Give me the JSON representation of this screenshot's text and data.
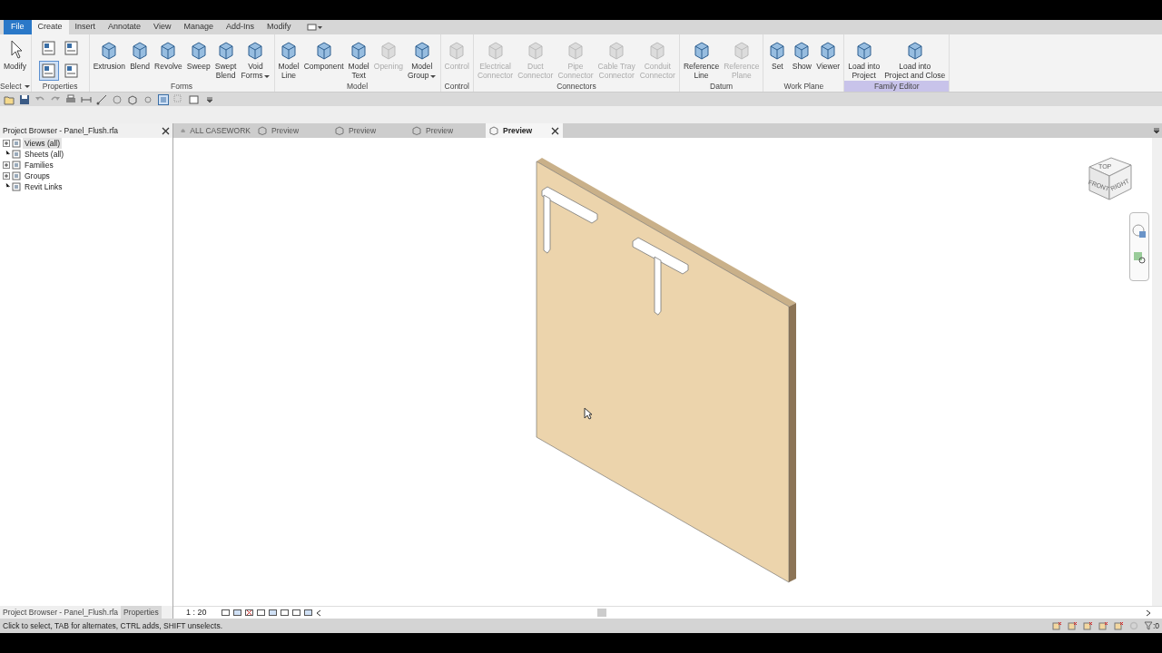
{
  "ribbon_tabs": [
    {
      "label": "File",
      "kind": "application",
      "selected": false
    },
    {
      "label": "Create",
      "kind": "tab",
      "selected": true
    },
    {
      "label": "Insert",
      "kind": "tab",
      "selected": false
    },
    {
      "label": "Annotate",
      "kind": "tab",
      "selected": false
    },
    {
      "label": "View",
      "kind": "tab",
      "selected": false
    },
    {
      "label": "Manage",
      "kind": "tab",
      "selected": false
    },
    {
      "label": "Add-Ins",
      "kind": "tab",
      "selected": false
    },
    {
      "label": "Modify",
      "kind": "tab",
      "selected": false
    }
  ],
  "ribbon_panels": [
    {
      "label": "Select",
      "dropdown": true,
      "highlighted": false,
      "tools": [
        {
          "lines": [
            "Modify"
          ],
          "disabled": false,
          "dropdown": false
        }
      ]
    },
    {
      "label": "Properties",
      "dropdown": false,
      "highlighted": false,
      "icon_tools": [
        {
          "selected": false
        },
        {
          "selected": false
        },
        {
          "selected": true
        },
        {
          "selected": false
        }
      ]
    },
    {
      "label": "Forms",
      "dropdown": false,
      "highlighted": false,
      "tools": [
        {
          "lines": [
            "Extrusion"
          ],
          "disabled": false,
          "dropdown": false
        },
        {
          "lines": [
            "Blend"
          ],
          "disabled": false,
          "dropdown": false
        },
        {
          "lines": [
            "Revolve"
          ],
          "disabled": false,
          "dropdown": false
        },
        {
          "lines": [
            "Sweep"
          ],
          "disabled": false,
          "dropdown": false
        },
        {
          "lines": [
            "Swept",
            "Blend"
          ],
          "disabled": false,
          "dropdown": false
        },
        {
          "lines": [
            "Void",
            "Forms"
          ],
          "disabled": false,
          "dropdown": true
        }
      ]
    },
    {
      "label": "Model",
      "dropdown": false,
      "highlighted": false,
      "tools": [
        {
          "lines": [
            "Model",
            "Line"
          ],
          "disabled": false,
          "dropdown": false
        },
        {
          "lines": [
            "Component"
          ],
          "disabled": false,
          "dropdown": false
        },
        {
          "lines": [
            "Model",
            "Text"
          ],
          "disabled": false,
          "dropdown": false
        },
        {
          "lines": [
            "Opening"
          ],
          "disabled": true,
          "dropdown": false
        },
        {
          "lines": [
            "Model",
            "Group"
          ],
          "disabled": false,
          "dropdown": true
        }
      ]
    },
    {
      "label": "Control",
      "dropdown": false,
      "highlighted": false,
      "tools": [
        {
          "lines": [
            "Control"
          ],
          "disabled": true,
          "dropdown": false
        }
      ]
    },
    {
      "label": "Connectors",
      "dropdown": false,
      "highlighted": false,
      "tools": [
        {
          "lines": [
            "Electrical",
            "Connector"
          ],
          "disabled": true,
          "dropdown": false
        },
        {
          "lines": [
            "Duct",
            "Connector"
          ],
          "disabled": true,
          "dropdown": false
        },
        {
          "lines": [
            "Pipe",
            "Connector"
          ],
          "disabled": true,
          "dropdown": false
        },
        {
          "lines": [
            "Cable Tray",
            "Connector"
          ],
          "disabled": true,
          "dropdown": false
        },
        {
          "lines": [
            "Conduit",
            "Connector"
          ],
          "disabled": true,
          "dropdown": false
        }
      ]
    },
    {
      "label": "Datum",
      "dropdown": false,
      "highlighted": false,
      "tools": [
        {
          "lines": [
            "Reference",
            "Line"
          ],
          "disabled": false,
          "dropdown": false
        },
        {
          "lines": [
            "Reference",
            "Plane"
          ],
          "disabled": true,
          "dropdown": false
        }
      ]
    },
    {
      "label": "Work Plane",
      "dropdown": false,
      "highlighted": false,
      "tools": [
        {
          "lines": [
            "Set"
          ],
          "disabled": false,
          "dropdown": false
        },
        {
          "lines": [
            "Show"
          ],
          "disabled": false,
          "dropdown": false
        },
        {
          "lines": [
            "Viewer"
          ],
          "disabled": false,
          "dropdown": false
        }
      ]
    },
    {
      "label": "Family Editor",
      "dropdown": false,
      "highlighted": true,
      "tools": [
        {
          "lines": [
            "Load into",
            "Project"
          ],
          "disabled": false,
          "dropdown": false
        },
        {
          "lines": [
            "Load into",
            "Project and Close"
          ],
          "disabled": false,
          "dropdown": false
        }
      ]
    }
  ],
  "project_browser": {
    "title": "Project Browser - Panel_Flush.rfa",
    "tree": [
      {
        "label": "Views (all)",
        "has_children": true,
        "selected": true
      },
      {
        "label": "Sheets (all)",
        "has_children": false,
        "selected": false
      },
      {
        "label": "Families",
        "has_children": true,
        "selected": false
      },
      {
        "label": "Groups",
        "has_children": true,
        "selected": false
      },
      {
        "label": "Revit Links",
        "has_children": false,
        "selected": false
      }
    ]
  },
  "view_tabs": [
    {
      "label": "ALL CASEWORK",
      "kind": "home",
      "selected": false
    },
    {
      "label": "Preview",
      "kind": "view",
      "selected": false
    },
    {
      "label": "Preview",
      "kind": "view",
      "selected": false
    },
    {
      "label": "Preview",
      "kind": "view",
      "selected": false
    },
    {
      "label": "Preview",
      "kind": "view",
      "selected": true
    }
  ],
  "viewcube": {
    "top": "TOP",
    "front": "FRONT",
    "right": "RIGHT"
  },
  "bottom_tabs": [
    {
      "label": "Project Browser - Panel_Flush.rfa",
      "selected": true
    },
    {
      "label": "Properties",
      "selected": false
    }
  ],
  "view_control_bar": {
    "scale": "1 : 20"
  },
  "status_bar": {
    "text": "Click to select, TAB for alternates, CTRL adds, SHIFT unselects.",
    "filter_count": ":0"
  }
}
